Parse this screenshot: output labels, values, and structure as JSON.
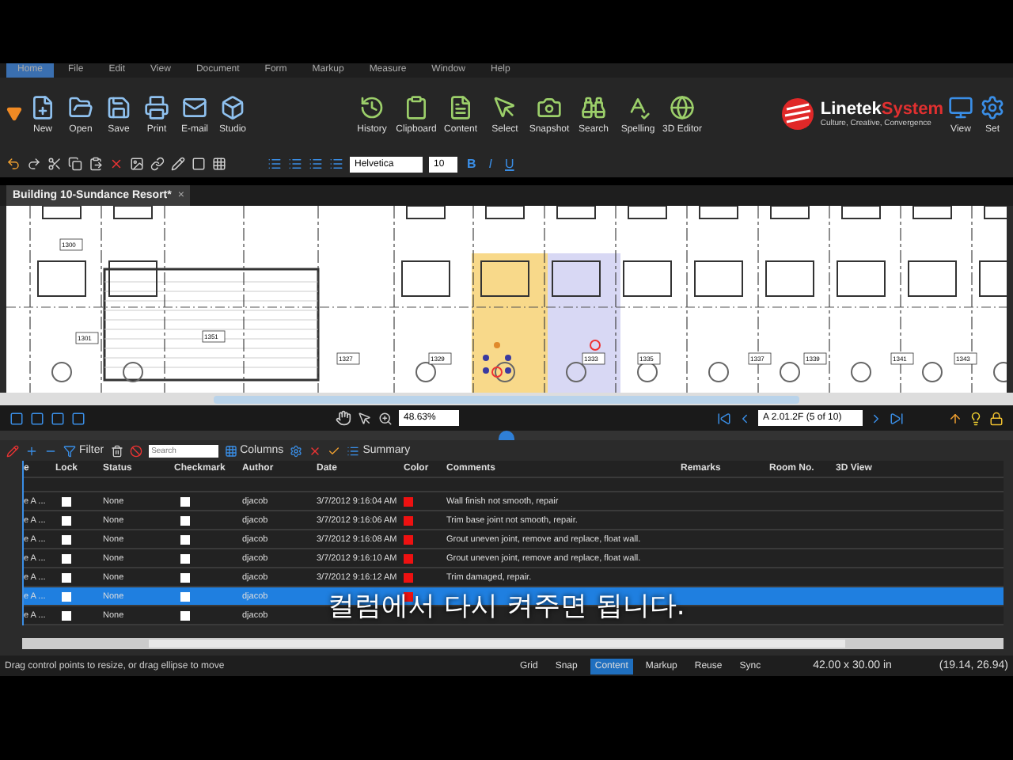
{
  "menu": [
    {
      "label": "Home",
      "selected": true
    },
    {
      "label": "File",
      "selected": false
    },
    {
      "label": "Edit",
      "selected": false
    },
    {
      "label": "View",
      "selected": false
    },
    {
      "label": "Document",
      "selected": false
    },
    {
      "label": "Form",
      "selected": false
    },
    {
      "label": "Markup",
      "selected": false
    },
    {
      "label": "Measure",
      "selected": false
    },
    {
      "label": "Window",
      "selected": false
    },
    {
      "label": "Help",
      "selected": false
    }
  ],
  "ribbon_left": [
    "New",
    "Open",
    "Save",
    "Print",
    "E-mail",
    "Studio"
  ],
  "ribbon_mid": [
    "History",
    "Clipboard",
    "Content",
    "Select",
    "Snapshot",
    "Search",
    "Spelling",
    "3D Editor"
  ],
  "logo": {
    "name_a": "Linetek",
    "name_b": "System",
    "tagline": "Culture, Creative, Convergence"
  },
  "ribbon_right": [
    "View",
    "Set"
  ],
  "format_bar": {
    "font": "Helvetica",
    "size": "10",
    "styles": [
      "B",
      "I",
      "U"
    ]
  },
  "document_tab": {
    "title": "Building 10-Sundance Resort*",
    "close": "×"
  },
  "floor_plan": {
    "rooms": [
      "1300",
      "1301",
      "1351",
      "1327",
      "1329",
      "1333",
      "1335",
      "1337",
      "1339",
      "1341",
      "1343"
    ]
  },
  "nav_bar": {
    "zoom": "48.63%",
    "page": "A 2.01.2F (5 of 10)"
  },
  "markup_toolbar": {
    "filter": "Filter",
    "search_placeholder": "Search",
    "columns": "Columns",
    "summary": "Summary"
  },
  "table": {
    "columns": [
      "e",
      "Lock",
      "Status",
      "Checkmark",
      "Author",
      "Date",
      "Color",
      "Comments",
      "Remarks",
      "Room No.",
      "3D View"
    ],
    "rows": [
      {
        "type": "e A ...",
        "lock": false,
        "status": "None",
        "checkmark": false,
        "author": "djacob",
        "date": "3/7/2012 9:16:04 AM",
        "color": "#ee1111",
        "comment": "Wall finish not smooth, repair",
        "selected": false
      },
      {
        "type": "e A ...",
        "lock": false,
        "status": "None",
        "checkmark": false,
        "author": "djacob",
        "date": "3/7/2012 9:16:06 AM",
        "color": "#ee1111",
        "comment": "Trim base joint not smooth, repair.",
        "selected": false
      },
      {
        "type": "e A ...",
        "lock": false,
        "status": "None",
        "checkmark": false,
        "author": "djacob",
        "date": "3/7/2012 9:16:08 AM",
        "color": "#ee1111",
        "comment": "Grout uneven joint, remove and replace, float wall.",
        "selected": false
      },
      {
        "type": "e A ...",
        "lock": false,
        "status": "None",
        "checkmark": false,
        "author": "djacob",
        "date": "3/7/2012 9:16:10 AM",
        "color": "#ee1111",
        "comment": "Grout uneven joint, remove and replace, float wall.",
        "selected": false
      },
      {
        "type": "e A ...",
        "lock": false,
        "status": "None",
        "checkmark": false,
        "author": "djacob",
        "date": "3/7/2012 9:16:12 AM",
        "color": "#ee1111",
        "comment": "Trim damaged, repair.",
        "selected": false
      },
      {
        "type": "e A ...",
        "lock": false,
        "status": "None",
        "checkmark": false,
        "author": "djacob",
        "color": "#ee1111",
        "selected": true
      },
      {
        "type": "e A ...",
        "lock": false,
        "status": "None",
        "checkmark": false,
        "author": "djacob",
        "selected": false
      }
    ]
  },
  "subtitle": "컬럼에서 다시 켜주면 됩니다.",
  "status_bar": {
    "hint": "Drag control points to resize, or drag ellipse to move",
    "toggles": [
      {
        "label": "Grid",
        "selected": false
      },
      {
        "label": "Snap",
        "selected": false
      },
      {
        "label": "Content",
        "selected": true
      },
      {
        "label": "Markup",
        "selected": false
      },
      {
        "label": "Reuse",
        "selected": false
      },
      {
        "label": "Sync",
        "selected": false
      }
    ],
    "size": "42.00 x 30.00 in",
    "coords": "(19.14, 26.94)"
  }
}
